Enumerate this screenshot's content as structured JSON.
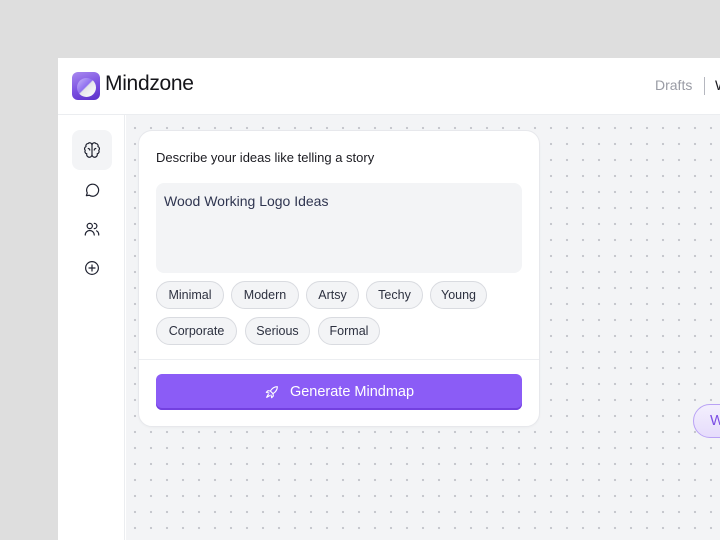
{
  "header": {
    "brand": "Mindzone",
    "nav": [
      {
        "label": "Drafts"
      },
      {
        "label": "W"
      }
    ]
  },
  "sidebar": {
    "items": [
      {
        "icon": "brain-icon",
        "label": "Mindmap",
        "active": true
      },
      {
        "icon": "chat-bubble-icon",
        "label": "Chat",
        "active": false
      },
      {
        "icon": "users-icon",
        "label": "Users",
        "active": false
      },
      {
        "icon": "plus-circle-icon",
        "label": "Add",
        "active": false
      }
    ]
  },
  "prompt_card": {
    "title": "Describe your ideas like telling a story",
    "input_value": "Wood Working Logo Ideas",
    "chips": [
      "Minimal",
      "Modern",
      "Artsy",
      "Techy",
      "Young",
      "Corporate",
      "Serious",
      "Formal"
    ],
    "generate_label": "Generate Mindmap",
    "generate_icon": "rocket-icon"
  },
  "canvas": {
    "node_label": "W"
  },
  "colors": {
    "accent": "#8b5cf6",
    "canvas_bg": "#f3f4f6",
    "input_text": "#2f3550"
  }
}
